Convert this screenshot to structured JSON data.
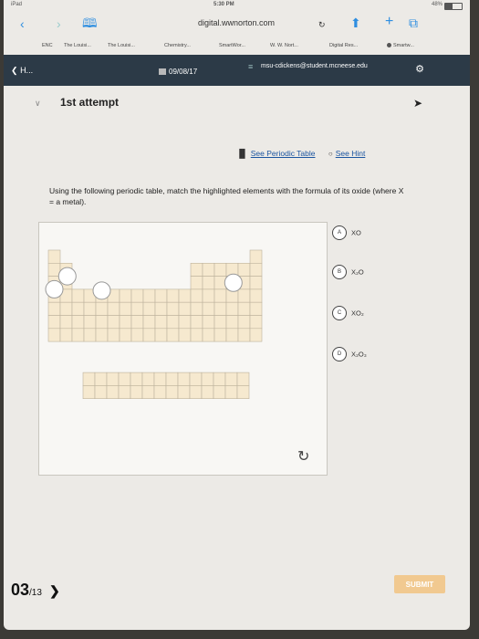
{
  "status": {
    "carrier": "iPad",
    "time": "5:30 PM",
    "battery": "48%"
  },
  "browser": {
    "url": "digital.wwnorton.com",
    "bookmarks": [
      "ENC",
      "The Louisi...",
      "The Louisi...",
      "Chemistry...",
      "SmartWor...",
      "W. W. Nort...",
      "Digital Res...",
      "Smartw..."
    ]
  },
  "header": {
    "back_label": "H...",
    "date": "09/08/17",
    "email": "msu-cdickens@student.mcneese.edu"
  },
  "attempt": {
    "title": "1st attempt"
  },
  "links": {
    "periodic_table": "See Periodic Table",
    "hint": "See Hint"
  },
  "question": {
    "text": "Using the following periodic table, match the highlighted elements with the formula of its oxide (where X = a metal)."
  },
  "options": [
    {
      "letter": "A",
      "formula": "XO"
    },
    {
      "letter": "B",
      "formula": "X₂O"
    },
    {
      "letter": "C",
      "formula": "XO₂"
    },
    {
      "letter": "D",
      "formula": "X₂O₃"
    }
  ],
  "footer": {
    "current": "03",
    "total": "/13",
    "submit_label": "SUBMIT"
  },
  "colors": {
    "header_bg": "#2c3a47",
    "cell_fill": "#f6e9cf",
    "cell_border": "#bdb29c",
    "link": "#1b55a0",
    "submit_bg": "#f1c990",
    "ios_blue": "#2e8ee0"
  },
  "icons": {
    "back": "chevron-left-icon",
    "refresh": "refresh-icon",
    "next": "chevron-right-icon"
  }
}
